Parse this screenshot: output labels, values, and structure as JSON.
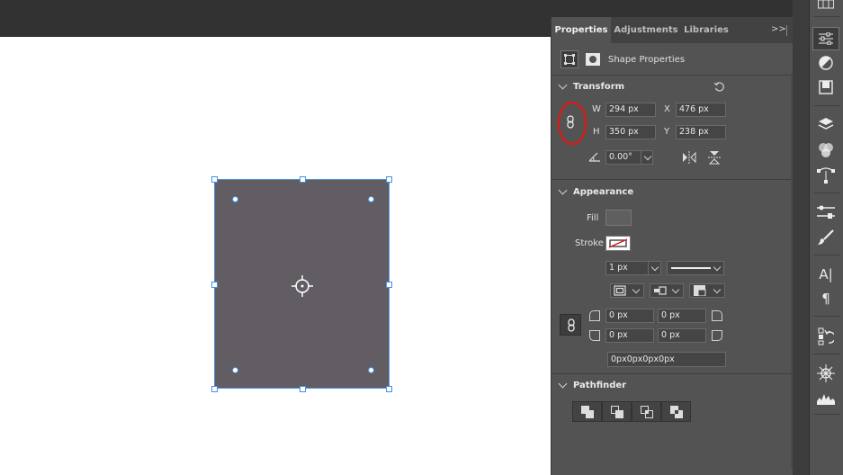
{
  "panel": {
    "tabs": [
      {
        "label": "Properties",
        "active": true
      },
      {
        "label": "Adjustments",
        "active": false
      },
      {
        "label": "Libraries",
        "active": false
      }
    ],
    "overflow_icon": "chevrons-right-icon",
    "menu_icon": "hamburger-menu-icon",
    "shape_properties_label": "Shape Properties"
  },
  "transform": {
    "title": "Transform",
    "w_label": "W",
    "w_value": "294 px",
    "x_label": "X",
    "x_value": "476 px",
    "h_label": "H",
    "h_value": "350 px",
    "y_label": "Y",
    "y_value": "238 px",
    "angle_value": "0.00°"
  },
  "appearance": {
    "title": "Appearance",
    "fill_label": "Fill",
    "fill_color": "#5f5f5f",
    "stroke_label": "Stroke",
    "stroke_width": "1 px",
    "corners": {
      "top_left": "0 px",
      "top_right": "0 px",
      "bottom_left": "0 px",
      "bottom_right": "0 px",
      "combined": "0px0px0px0px"
    }
  },
  "pathfinder": {
    "title": "Pathfinder"
  },
  "colors": {
    "selection": "#4a8fe0",
    "shape_fill": "#615d63",
    "annotation_circle": "#d0201c"
  }
}
